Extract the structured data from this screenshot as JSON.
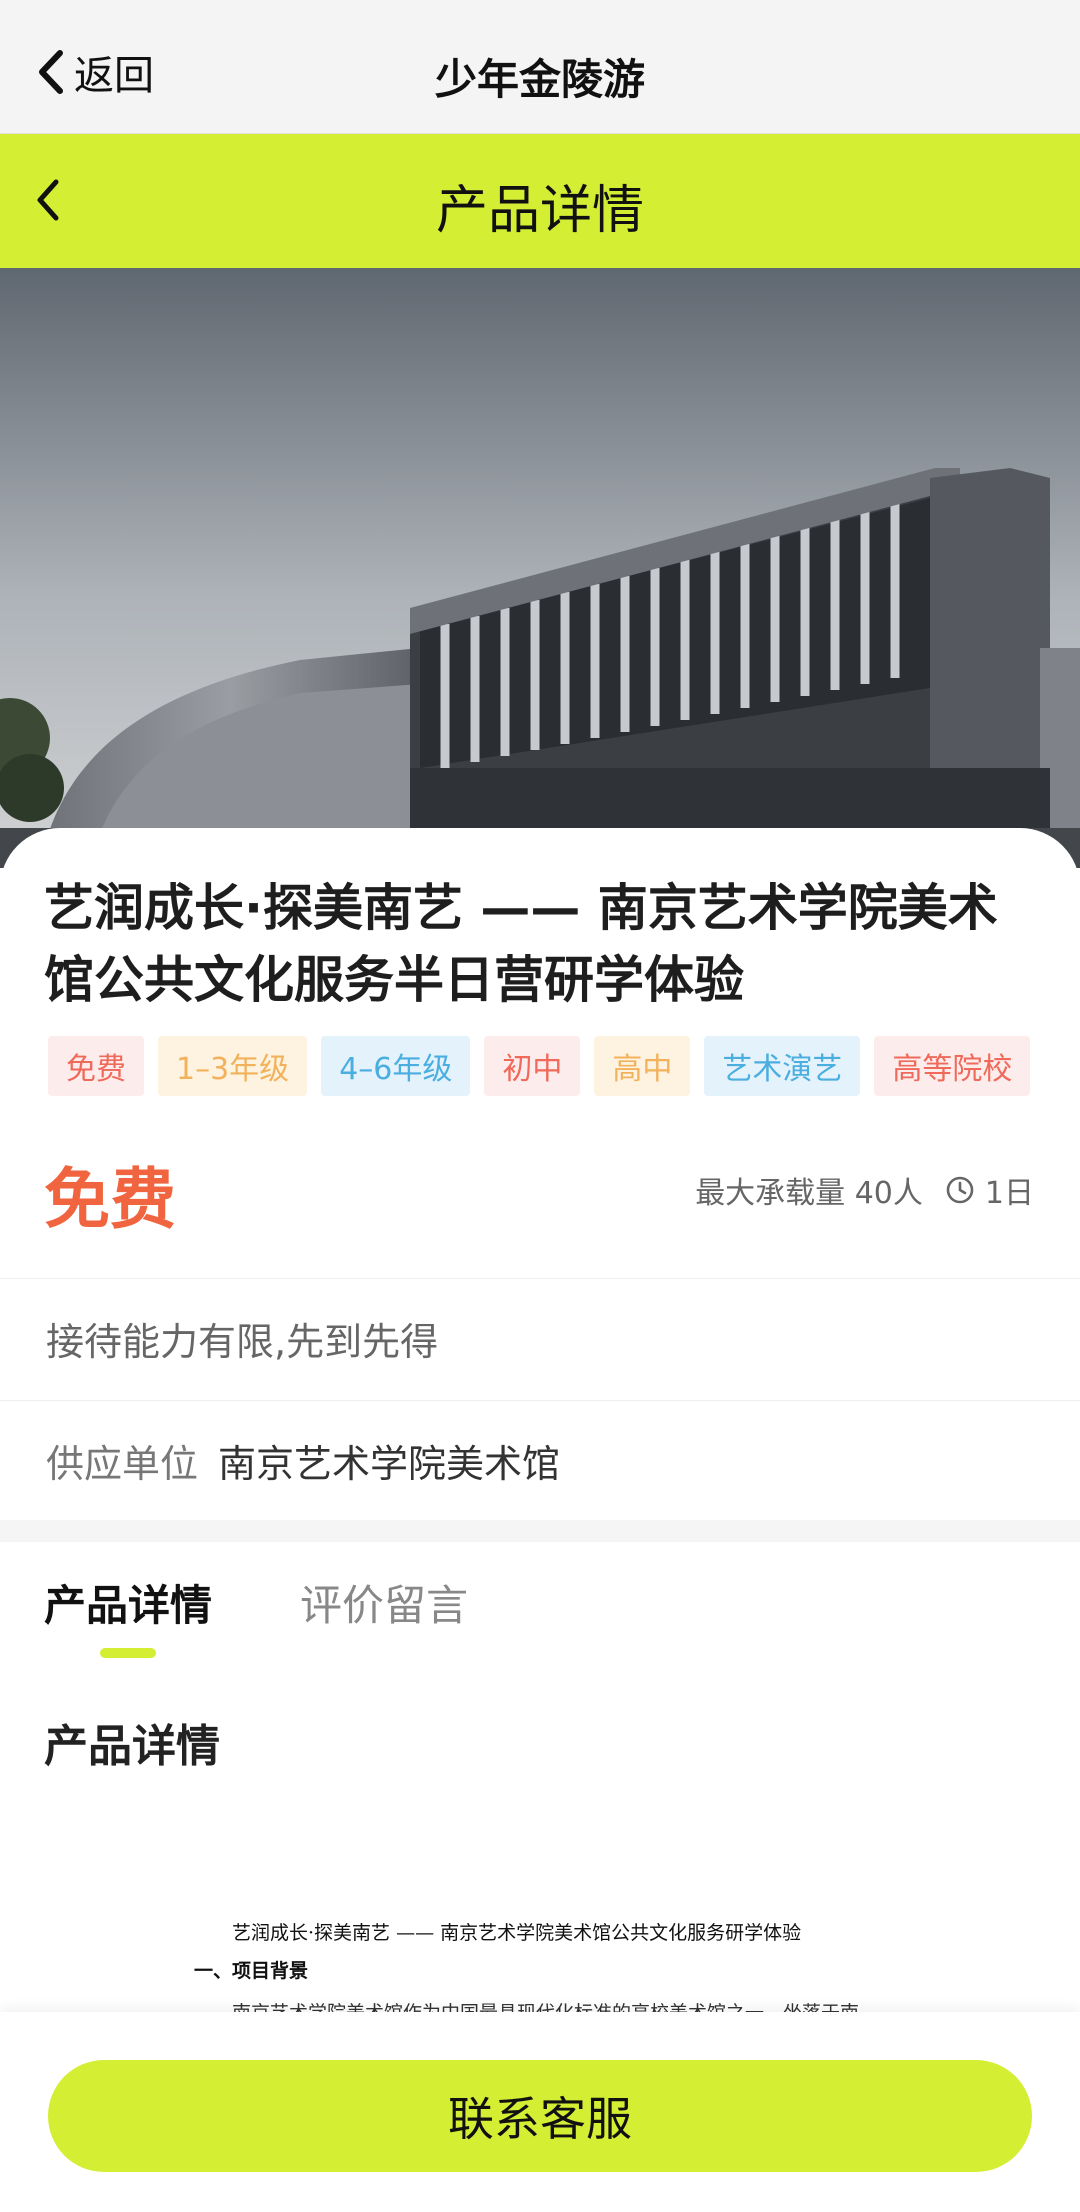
{
  "topbar": {
    "back_label": "返回",
    "title": "少年金陵游"
  },
  "header": {
    "title": "产品详情"
  },
  "product": {
    "title": "艺润成长·探美南艺 —— 南京艺术学院美术馆公共文化服务半日营研学体验",
    "tags": [
      {
        "label": "免费",
        "color": "red"
      },
      {
        "label": "1–3年级",
        "color": "orange"
      },
      {
        "label": "4–6年级",
        "color": "blue"
      },
      {
        "label": "初中",
        "color": "red"
      },
      {
        "label": "高中",
        "color": "orange"
      },
      {
        "label": "艺术演艺",
        "color": "blue"
      },
      {
        "label": "高等院校",
        "color": "red"
      }
    ],
    "price": "免费",
    "capacity": "最大承载量 40人",
    "duration": "1日",
    "notice": "接待能力有限,先到先得",
    "supplier_label": "供应单位",
    "supplier_value": "南京艺术学院美术馆"
  },
  "tabs": {
    "active": "产品详情",
    "inactive": "评价留言"
  },
  "section_title": "产品详情",
  "doc_preview": {
    "line1": "艺润成长·探美南艺 —— 南京艺术学院美术馆公共文化服务研学体验",
    "line2": "一、项目背景",
    "line3": "南京艺术学院美术馆作为中国最具现代化标准的高校美术馆之一，坐落于南"
  },
  "cta": {
    "label": "联系客服"
  },
  "colors": {
    "accent": "#d4ee33",
    "price": "#f0653f"
  }
}
